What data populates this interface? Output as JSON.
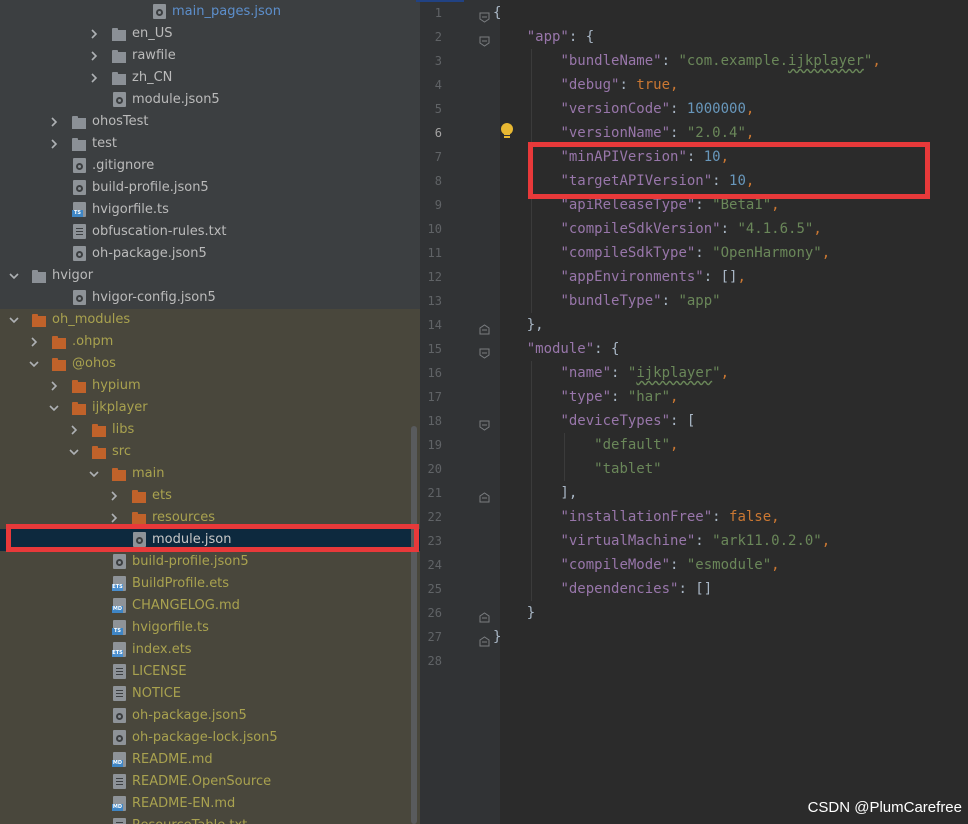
{
  "project_tree": {
    "items": [
      {
        "label": "main_pages.json",
        "type": "file",
        "icon": "json-config-file-icon",
        "indent": 6,
        "link": true
      },
      {
        "label": "en_US",
        "type": "folder",
        "icon": "folder-icon",
        "indent": 4,
        "expanded": false
      },
      {
        "label": "rawfile",
        "type": "folder",
        "icon": "folder-icon",
        "indent": 4,
        "expanded": false
      },
      {
        "label": "zh_CN",
        "type": "folder",
        "icon": "folder-icon",
        "indent": 4,
        "expanded": false
      },
      {
        "label": "module.json5",
        "type": "file",
        "icon": "json-config-file-icon",
        "indent": 4
      },
      {
        "label": "ohosTest",
        "type": "folder",
        "icon": "folder-icon",
        "indent": 2,
        "expanded": false
      },
      {
        "label": "test",
        "type": "folder",
        "icon": "folder-icon",
        "indent": 2,
        "expanded": false
      },
      {
        "label": ".gitignore",
        "type": "file",
        "icon": "config-file-icon",
        "indent": 2
      },
      {
        "label": "build-profile.json5",
        "type": "file",
        "icon": "json-config-file-icon",
        "indent": 2
      },
      {
        "label": "hvigorfile.ts",
        "type": "file",
        "icon": "typescript-file-icon",
        "indent": 2
      },
      {
        "label": "obfuscation-rules.txt",
        "type": "file",
        "icon": "text-file-icon",
        "indent": 2
      },
      {
        "label": "oh-package.json5",
        "type": "file",
        "icon": "json-config-file-icon",
        "indent": 2
      },
      {
        "label": "hvigor",
        "type": "folder",
        "icon": "folder-icon",
        "indent": 0,
        "expanded": true
      },
      {
        "label": "hvigor-config.json5",
        "type": "file",
        "icon": "json-config-file-icon",
        "indent": 2
      },
      {
        "label": "oh_modules",
        "type": "folder",
        "icon": "module-folder-icon",
        "indent": 0,
        "expanded": true,
        "yellow": true
      },
      {
        "label": ".ohpm",
        "type": "folder",
        "icon": "module-folder-icon",
        "indent": 1,
        "expanded": false,
        "yellow": true
      },
      {
        "label": "@ohos",
        "type": "folder",
        "icon": "module-folder-icon",
        "indent": 1,
        "expanded": true,
        "yellow": true
      },
      {
        "label": "hypium",
        "type": "folder",
        "icon": "module-folder-icon",
        "indent": 2,
        "expanded": false,
        "yellow": true
      },
      {
        "label": "ijkplayer",
        "type": "folder",
        "icon": "module-folder-icon",
        "indent": 2,
        "expanded": true,
        "yellow": true
      },
      {
        "label": "libs",
        "type": "folder",
        "icon": "module-folder-icon",
        "indent": 3,
        "expanded": false,
        "yellow": true
      },
      {
        "label": "src",
        "type": "folder",
        "icon": "module-folder-icon",
        "indent": 3,
        "expanded": true,
        "yellow": true
      },
      {
        "label": "main",
        "type": "folder",
        "icon": "module-folder-icon",
        "indent": 4,
        "expanded": true,
        "yellow": true
      },
      {
        "label": "ets",
        "type": "folder",
        "icon": "module-folder-icon",
        "indent": 5,
        "expanded": false,
        "yellow": true
      },
      {
        "label": "resources",
        "type": "folder",
        "icon": "module-folder-icon",
        "indent": 5,
        "expanded": false,
        "yellow": true
      },
      {
        "label": "module.json",
        "type": "file",
        "icon": "json-config-file-icon",
        "indent": 5,
        "selected": true
      },
      {
        "label": "build-profile.json5",
        "type": "file",
        "icon": "json-config-file-icon",
        "indent": 4,
        "yellow": true
      },
      {
        "label": "BuildProfile.ets",
        "type": "file",
        "icon": "ets-file-icon",
        "indent": 4,
        "yellow": true
      },
      {
        "label": "CHANGELOG.md",
        "type": "file",
        "icon": "markdown-file-icon",
        "indent": 4,
        "yellow": true
      },
      {
        "label": "hvigorfile.ts",
        "type": "file",
        "icon": "typescript-file-icon",
        "indent": 4,
        "yellow": true
      },
      {
        "label": "index.ets",
        "type": "file",
        "icon": "ets-file-icon",
        "indent": 4,
        "yellow": true
      },
      {
        "label": "LICENSE",
        "type": "file",
        "icon": "text-file-icon",
        "indent": 4,
        "yellow": true
      },
      {
        "label": "NOTICE",
        "type": "file",
        "icon": "text-file-icon",
        "indent": 4,
        "yellow": true
      },
      {
        "label": "oh-package.json5",
        "type": "file",
        "icon": "json-config-file-icon",
        "indent": 4,
        "yellow": true
      },
      {
        "label": "oh-package-lock.json5",
        "type": "file",
        "icon": "json-config-file-icon",
        "indent": 4,
        "yellow": true
      },
      {
        "label": "README.md",
        "type": "file",
        "icon": "markdown-file-icon",
        "indent": 4,
        "yellow": true
      },
      {
        "label": "README.OpenSource",
        "type": "file",
        "icon": "text-file-icon",
        "indent": 4,
        "yellow": true
      },
      {
        "label": "README-EN.md",
        "type": "file",
        "icon": "markdown-file-icon",
        "indent": 4,
        "yellow": true
      },
      {
        "label": "ResourceTable.txt",
        "type": "file",
        "icon": "text-file-icon",
        "indent": 4,
        "yellow": true
      }
    ]
  },
  "editor": {
    "current_line": 6,
    "lines": [
      [
        [
          "p",
          "{"
        ]
      ],
      [
        [
          "p",
          "    "
        ],
        [
          "k",
          "\"app\""
        ],
        [
          "p",
          ": {"
        ]
      ],
      [
        [
          "p",
          "        "
        ],
        [
          "k",
          "\"bundleName\""
        ],
        [
          "p",
          ": "
        ],
        [
          "s",
          "\"com.example."
        ],
        [
          "sq",
          "ijkplayer"
        ],
        [
          "s",
          "\""
        ],
        [
          "b",
          ","
        ]
      ],
      [
        [
          "p",
          "        "
        ],
        [
          "k",
          "\"debug\""
        ],
        [
          "p",
          ": "
        ],
        [
          "b",
          "true"
        ],
        [
          "b",
          ","
        ]
      ],
      [
        [
          "p",
          "        "
        ],
        [
          "k",
          "\"versionCode\""
        ],
        [
          "p",
          ": "
        ],
        [
          "n",
          "1000000"
        ],
        [
          "b",
          ","
        ]
      ],
      [
        [
          "p",
          "        "
        ],
        [
          "k",
          "\"versionName\""
        ],
        [
          "p",
          ": "
        ],
        [
          "s",
          "\"2.0.4\""
        ],
        [
          "b",
          ","
        ]
      ],
      [
        [
          "p",
          "        "
        ],
        [
          "k",
          "\"minAPIVersion\""
        ],
        [
          "p",
          ": "
        ],
        [
          "n",
          "10"
        ],
        [
          "b",
          ","
        ]
      ],
      [
        [
          "p",
          "        "
        ],
        [
          "k",
          "\"targetAPIVersion\""
        ],
        [
          "p",
          ": "
        ],
        [
          "n",
          "10"
        ],
        [
          "b",
          ","
        ]
      ],
      [
        [
          "p",
          "        "
        ],
        [
          "k",
          "\"apiReleaseType\""
        ],
        [
          "p",
          ": "
        ],
        [
          "s",
          "\"Beta1\""
        ],
        [
          "b",
          ","
        ]
      ],
      [
        [
          "p",
          "        "
        ],
        [
          "k",
          "\"compileSdkVersion\""
        ],
        [
          "p",
          ": "
        ],
        [
          "s",
          "\"4.1.6.5\""
        ],
        [
          "b",
          ","
        ]
      ],
      [
        [
          "p",
          "        "
        ],
        [
          "k",
          "\"compileSdkType\""
        ],
        [
          "p",
          ": "
        ],
        [
          "s",
          "\"OpenHarmony\""
        ],
        [
          "b",
          ","
        ]
      ],
      [
        [
          "p",
          "        "
        ],
        [
          "k",
          "\"appEnvironments\""
        ],
        [
          "p",
          ": []"
        ],
        [
          "b",
          ","
        ]
      ],
      [
        [
          "p",
          "        "
        ],
        [
          "k",
          "\"bundleType\""
        ],
        [
          "p",
          ": "
        ],
        [
          "s",
          "\"app\""
        ]
      ],
      [
        [
          "p",
          "    },"
        ]
      ],
      [
        [
          "p",
          "    "
        ],
        [
          "k",
          "\"module\""
        ],
        [
          "p",
          ": {"
        ]
      ],
      [
        [
          "p",
          "        "
        ],
        [
          "k",
          "\"name\""
        ],
        [
          "p",
          ": "
        ],
        [
          "s",
          "\""
        ],
        [
          "sq",
          "ijkplayer"
        ],
        [
          "s",
          "\""
        ],
        [
          "b",
          ","
        ]
      ],
      [
        [
          "p",
          "        "
        ],
        [
          "k",
          "\"type\""
        ],
        [
          "p",
          ": "
        ],
        [
          "s",
          "\"har\""
        ],
        [
          "b",
          ","
        ]
      ],
      [
        [
          "p",
          "        "
        ],
        [
          "k",
          "\"deviceTypes\""
        ],
        [
          "p",
          ": ["
        ]
      ],
      [
        [
          "p",
          "            "
        ],
        [
          "s",
          "\"default\""
        ],
        [
          "b",
          ","
        ]
      ],
      [
        [
          "p",
          "            "
        ],
        [
          "s",
          "\"tablet\""
        ]
      ],
      [
        [
          "p",
          "        ],"
        ]
      ],
      [
        [
          "p",
          "        "
        ],
        [
          "k",
          "\"installationFree\""
        ],
        [
          "p",
          ": "
        ],
        [
          "b",
          "false"
        ],
        [
          "b",
          ","
        ]
      ],
      [
        [
          "p",
          "        "
        ],
        [
          "k",
          "\"virtualMachine\""
        ],
        [
          "p",
          ": "
        ],
        [
          "s",
          "\"ark11.0.2.0\""
        ],
        [
          "b",
          ","
        ]
      ],
      [
        [
          "p",
          "        "
        ],
        [
          "k",
          "\"compileMode\""
        ],
        [
          "p",
          ": "
        ],
        [
          "s",
          "\"esmodule\""
        ],
        [
          "b",
          ","
        ]
      ],
      [
        [
          "p",
          "        "
        ],
        [
          "k",
          "\"dependencies\""
        ],
        [
          "p",
          ": []"
        ]
      ],
      [
        [
          "p",
          "    }"
        ]
      ],
      [
        [
          "p",
          "}"
        ]
      ],
      [
        [
          "p",
          ""
        ]
      ]
    ],
    "line_numbers": [
      "1",
      "2",
      "3",
      "4",
      "5",
      "6",
      "7",
      "8",
      "9",
      "10",
      "11",
      "12",
      "13",
      "14",
      "15",
      "16",
      "17",
      "18",
      "19",
      "20",
      "21",
      "22",
      "23",
      "24",
      "25",
      "26",
      "27",
      "28"
    ]
  },
  "watermark": "CSDN @PlumCarefree",
  "colors": {
    "tree_bg": "#3c3f41",
    "modified_bg": "#49473c",
    "selected_bg": "#0d293e",
    "editor_bg": "#2b2b2b",
    "highlight_box": "#e8393a",
    "json_key": "#9876aa",
    "json_string": "#6a8759",
    "json_number": "#6897bb",
    "json_keyword": "#cc7832"
  }
}
